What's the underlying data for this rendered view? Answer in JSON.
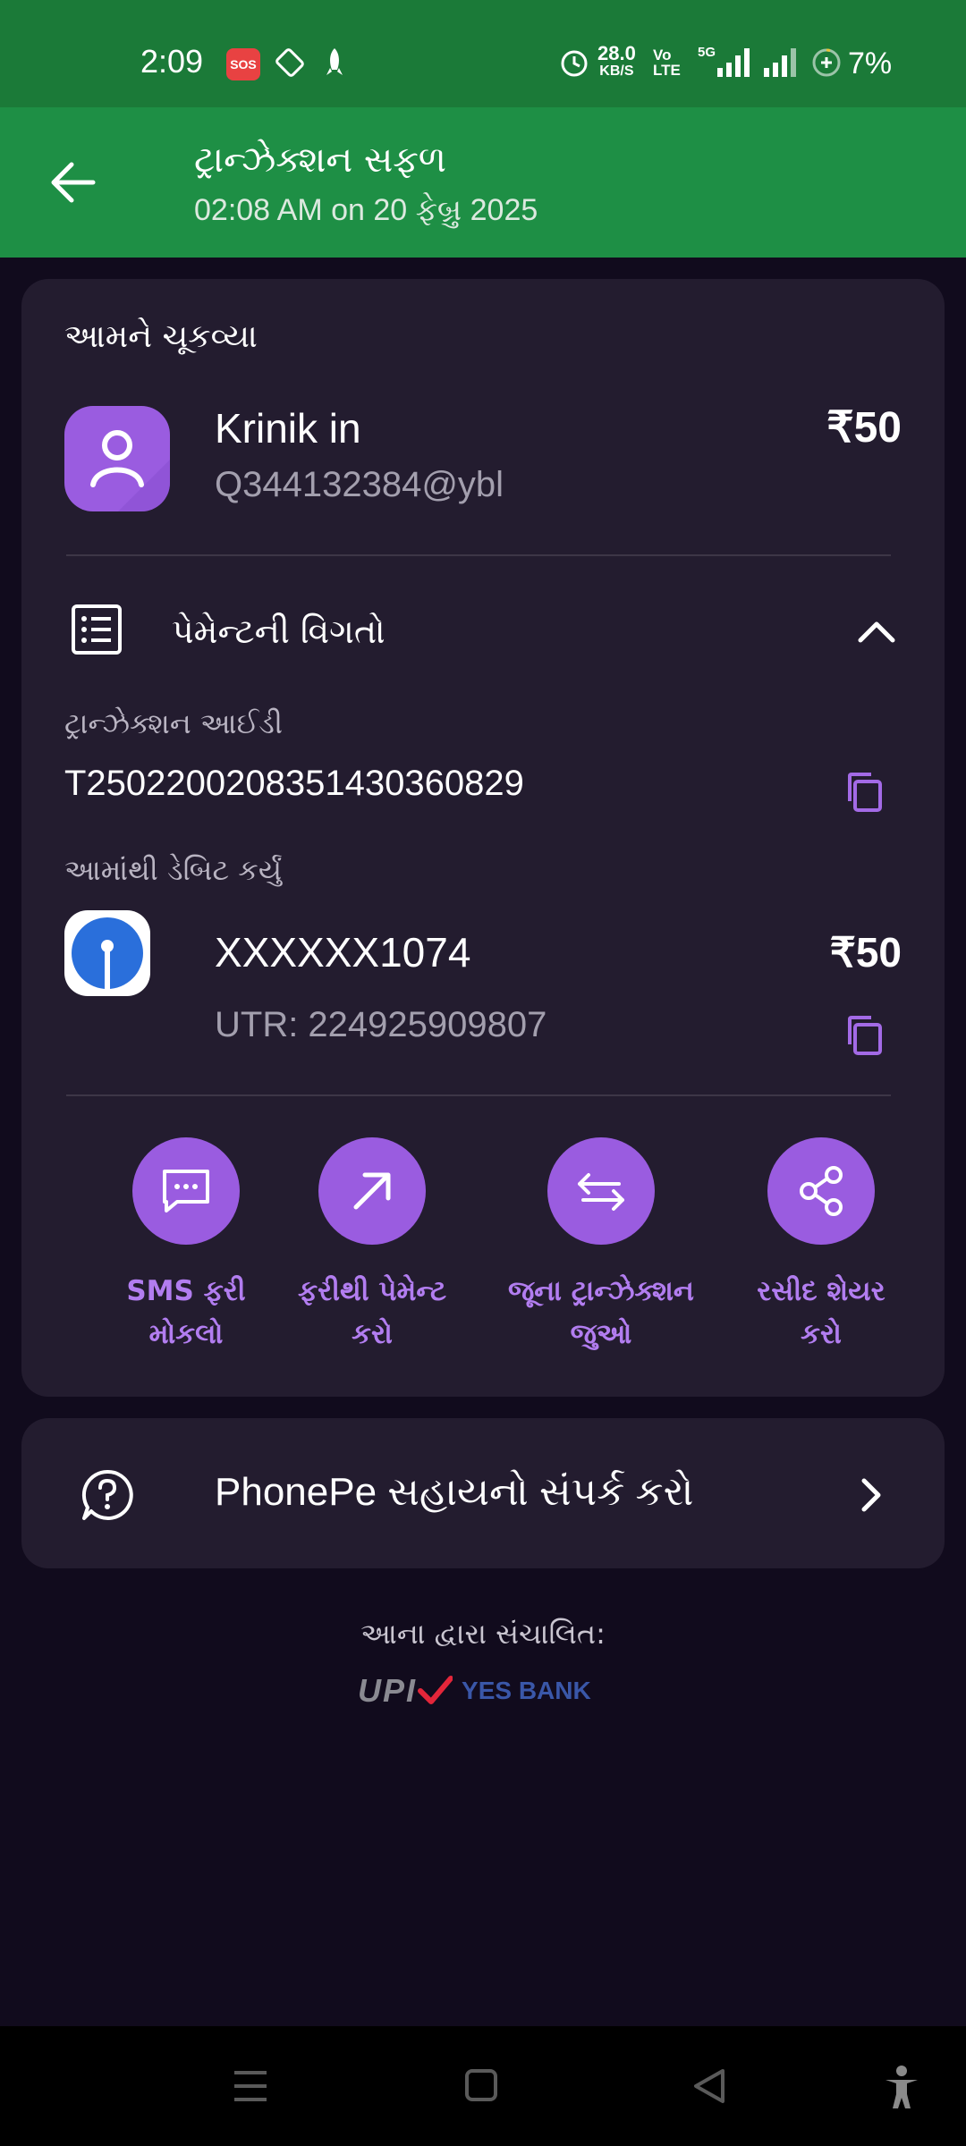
{
  "status_bar": {
    "time": "2:09",
    "sos": "SOS",
    "net_speed": "28.0",
    "net_unit": "KB/S",
    "volte_top": "Vo",
    "volte_bottom": "LTE",
    "network_type": "5G",
    "battery": "7%"
  },
  "header": {
    "title": "ટ્રાન્ઝેક્શન સફળ",
    "subtitle": "02:08 AM on 20 ફેબ્રુ 2025"
  },
  "payment": {
    "paid_to_label": "આમને ચૂકવ્યા",
    "payee_name": "Krinik in",
    "payee_upi": "Q344132384@ybl",
    "amount": "₹50"
  },
  "details": {
    "title": "પેમેન્ટની વિગતો",
    "txn_id_label": "ટ્રાન્ઝેક્શન આઈડી",
    "txn_id": "T2502200208351430360829",
    "debited_from_label": "આમાંથી ડેબિટ કર્યું",
    "account": "XXXXXX1074",
    "debit_amount": "₹50",
    "utr": "UTR: 224925909807"
  },
  "actions": [
    {
      "line1": "SMS ફરી",
      "line2": "મોકલો",
      "icon": "message-icon"
    },
    {
      "line1": "ફરીથી પેમેન્ટ",
      "line2": "કરો",
      "icon": "arrow-up-right-icon"
    },
    {
      "line1": "જૂના ટ્રાન્ઝેક્શન",
      "line2": "જુઓ",
      "icon": "swap-arrows-icon"
    },
    {
      "line1": "રસીદ શેયર",
      "line2": "કરો",
      "icon": "share-icon"
    }
  ],
  "support": {
    "label": "PhonePe સહાયનો સંપર્ક કરો"
  },
  "footer": {
    "powered_by": "આના દ્વારા સંચાલિત:",
    "upi_logo": "UPI",
    "bank_logo": "YES BANK"
  },
  "colors": {
    "header_green": "#1e8f45",
    "status_green": "#1b7a38",
    "accent_purple": "#9a5ce0",
    "background": "#110b1d",
    "card": "#231c2f"
  }
}
